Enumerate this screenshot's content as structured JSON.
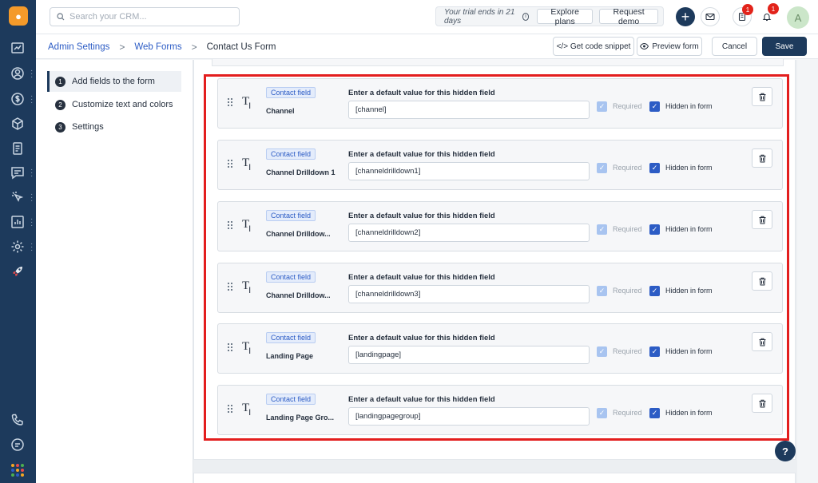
{
  "topbar": {
    "search_placeholder": "Search your CRM...",
    "trial_text": "Your trial ends in 21 days",
    "explore_plans": "Explore plans",
    "request_demo": "Request demo",
    "plus": "+",
    "notif_badge_1": "1",
    "notif_badge_2": "1",
    "avatar_initial": "A"
  },
  "breadcrumb": {
    "admin": "Admin Settings",
    "web_forms": "Web Forms",
    "current": "Contact Us Form",
    "sep": ">"
  },
  "actions": {
    "code_snippet": "</> Get code snippet",
    "preview": "Preview form",
    "cancel": "Cancel",
    "save": "Save"
  },
  "steps": [
    {
      "num": "1",
      "label": "Add fields to the form"
    },
    {
      "num": "2",
      "label": "Customize text and colors"
    },
    {
      "num": "3",
      "label": "Settings"
    }
  ],
  "field_common": {
    "tag": "Contact field",
    "default_label": "Enter a default value for this hidden field",
    "required": "Required",
    "hidden": "Hidden in form"
  },
  "fields": [
    {
      "name": "Channel",
      "value": "[channel]"
    },
    {
      "name": "Channel Drilldown 1",
      "value": "[channeldrilldown1]"
    },
    {
      "name": "Channel Drilldow...",
      "value": "[channeldrilldown2]"
    },
    {
      "name": "Channel Drilldow...",
      "value": "[channeldrilldown3]"
    },
    {
      "name": "Landing Page",
      "value": "[landingpage]"
    },
    {
      "name": "Landing Page Gro...",
      "value": "[landingpagegroup]"
    }
  ],
  "help": "?",
  "colors": {
    "brand": "#1d3a5c",
    "accent": "#2c5cc5",
    "highlight": "#e31e1e",
    "logo": "#f49a2a"
  }
}
